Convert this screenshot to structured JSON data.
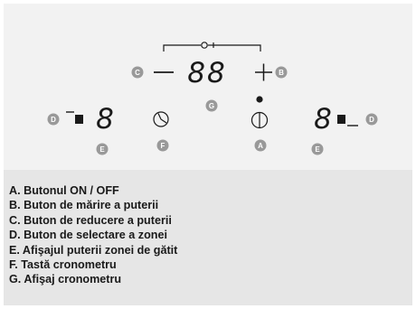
{
  "panel": {
    "timer_display": "88",
    "zone_left_display": "8",
    "zone_right_display": "8",
    "labels": {
      "A": "A",
      "B": "B",
      "C": "C",
      "D_left": "D",
      "D_right": "D",
      "E_left": "E",
      "E_right": "E",
      "F": "F",
      "G": "G"
    },
    "colors": {
      "panel_bg": "#f2f2f2",
      "legend_bg": "#e6e6e6",
      "badge": "#999999",
      "line": "#1a1a1a"
    }
  },
  "legend": {
    "items": [
      "A. Butonul ON / OFF",
      "B. Buton de mărire a puterii",
      "C. Buton de reducere a puterii",
      "D. Buton de selectare a zonei",
      "E. Afişajul puterii zonei de gătit",
      "F. Tastă cronometru",
      "G. Afişaj cronometru"
    ]
  }
}
